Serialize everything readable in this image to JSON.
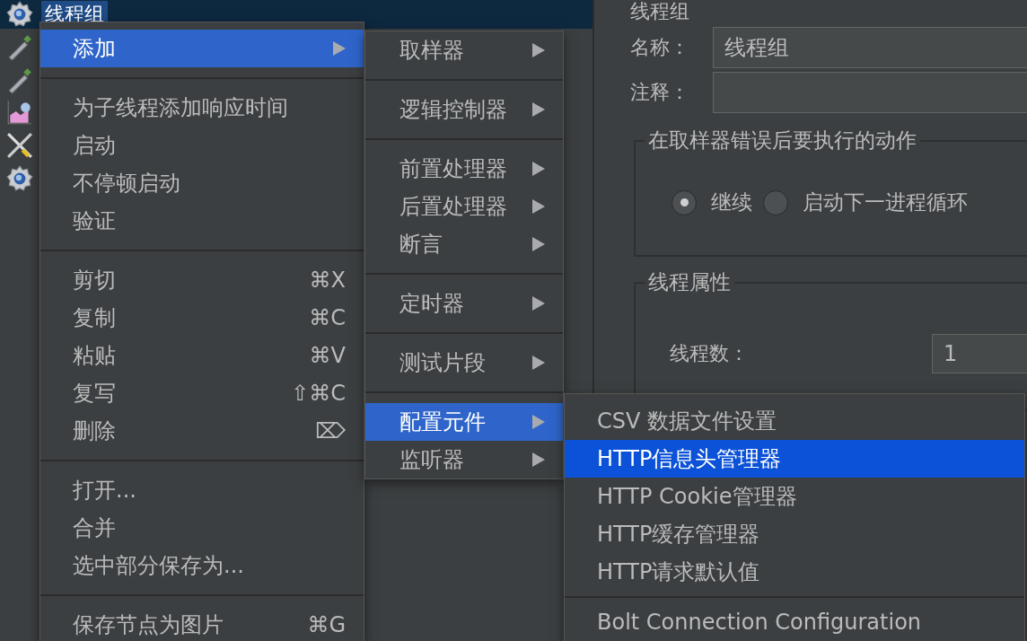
{
  "tree": {
    "items": [
      {
        "kind": "gear",
        "label": "线程组",
        "selected": true
      },
      {
        "kind": "pipette"
      },
      {
        "kind": "pipette"
      },
      {
        "kind": "chart"
      },
      {
        "kind": "tools"
      },
      {
        "kind": "gear"
      }
    ]
  },
  "panel": {
    "title": "线程组",
    "name_label": "名称：",
    "name_value": "线程组",
    "comment_label": "注释：",
    "error_action": {
      "legend": "在取样器错误后要执行的动作",
      "options": [
        {
          "label": "继续",
          "selected": true
        },
        {
          "label": "启动下一进程循环",
          "selected": false
        }
      ]
    },
    "thread_props": {
      "legend": "线程属性",
      "threads_label": "线程数：",
      "threads_value": "1"
    }
  },
  "context_menu": {
    "items": [
      {
        "kind": "item",
        "label": "添加",
        "submenu": true,
        "selected": true
      },
      {
        "kind": "separator"
      },
      {
        "kind": "item",
        "label": "为子线程添加响应时间",
        "selected": false
      },
      {
        "kind": "item",
        "label": "启动",
        "selected": false
      },
      {
        "kind": "item",
        "label": "不停顿启动",
        "selected": false
      },
      {
        "kind": "item",
        "label": "验证",
        "selected": false
      },
      {
        "kind": "separator"
      },
      {
        "kind": "item",
        "label": "剪切",
        "shortcut": "⌘X",
        "selected": false
      },
      {
        "kind": "item",
        "label": "复制",
        "shortcut": "⌘C",
        "selected": false
      },
      {
        "kind": "item",
        "label": "粘贴",
        "shortcut": "⌘V",
        "selected": false
      },
      {
        "kind": "item",
        "label": "复写",
        "shortcut": "⇧⌘C",
        "selected": false
      },
      {
        "kind": "item",
        "label": "删除",
        "shortcut": "⌦",
        "selected": false
      },
      {
        "kind": "separator"
      },
      {
        "kind": "item",
        "label": "打开...",
        "selected": false
      },
      {
        "kind": "item",
        "label": "合并",
        "selected": false
      },
      {
        "kind": "item",
        "label": "选中部分保存为...",
        "selected": false
      },
      {
        "kind": "separator"
      },
      {
        "kind": "item",
        "label": "保存节点为图片",
        "shortcut": "⌘G",
        "selected": false
      }
    ]
  },
  "add_submenu": {
    "items": [
      {
        "kind": "item",
        "label": "取样器",
        "submenu": true,
        "selected": false
      },
      {
        "kind": "separator"
      },
      {
        "kind": "item",
        "label": "逻辑控制器",
        "submenu": true,
        "selected": false
      },
      {
        "kind": "separator"
      },
      {
        "kind": "item",
        "label": "前置处理器",
        "submenu": true,
        "selected": false
      },
      {
        "kind": "item",
        "label": "后置处理器",
        "submenu": true,
        "selected": false
      },
      {
        "kind": "item",
        "label": "断言",
        "submenu": true,
        "selected": false
      },
      {
        "kind": "separator"
      },
      {
        "kind": "item",
        "label": "定时器",
        "submenu": true,
        "selected": false
      },
      {
        "kind": "separator"
      },
      {
        "kind": "item",
        "label": "测试片段",
        "submenu": true,
        "selected": false
      },
      {
        "kind": "separator"
      },
      {
        "kind": "item",
        "label": "配置元件",
        "submenu": true,
        "selected": true
      },
      {
        "kind": "item",
        "label": "监听器",
        "submenu": true,
        "selected": false
      }
    ]
  },
  "config_submenu": {
    "items": [
      {
        "kind": "item",
        "label": "CSV 数据文件设置",
        "selected": false
      },
      {
        "kind": "item",
        "label": "HTTP信息头管理器",
        "selected": true
      },
      {
        "kind": "item",
        "label": "HTTP Cookie管理器",
        "selected": false
      },
      {
        "kind": "item",
        "label": "HTTP缓存管理器",
        "selected": false
      },
      {
        "kind": "item",
        "label": "HTTP请求默认值",
        "selected": false
      },
      {
        "kind": "separator"
      },
      {
        "kind": "item",
        "label": "Bolt Connection Configuration",
        "selected": false
      }
    ]
  }
}
